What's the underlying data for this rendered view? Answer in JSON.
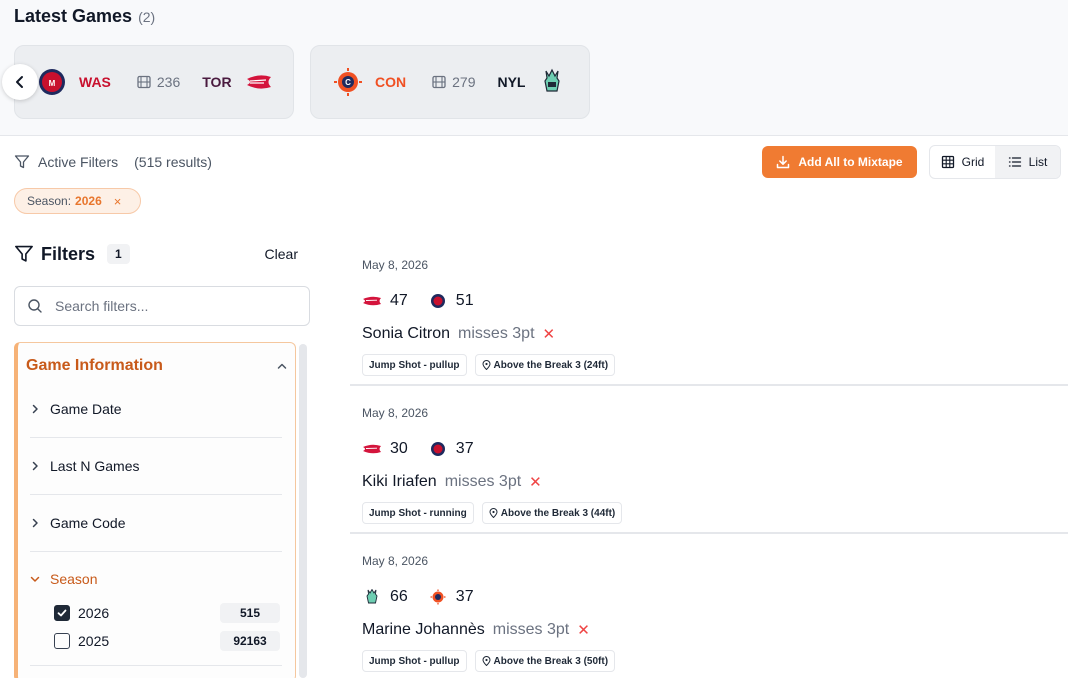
{
  "latest_games": {
    "title": "Latest Games",
    "count": "(2)",
    "games": [
      {
        "home": "WAS",
        "clips": "236",
        "away": "TOR",
        "home_color": "#c8102e",
        "away_color": "#4a1a3f"
      },
      {
        "home": "CON",
        "clips": "279",
        "away": "NYL",
        "home_color": "#f05023",
        "away_color": "#111827"
      }
    ]
  },
  "active_filters": {
    "label": "Active Filters",
    "results": "(515 results)",
    "chip_key": "Season:",
    "chip_value": "2026",
    "chip_remove": "×"
  },
  "toolbar": {
    "add_all": "Add All to Mixtape",
    "grid": "Grid",
    "list": "List",
    "accent": "#f07b32"
  },
  "filters": {
    "title": "Filters",
    "count": "1",
    "clear": "Clear",
    "search_placeholder": "Search filters...",
    "section_title": "Game Information",
    "items": [
      "Game Date",
      "Last N Games",
      "Game Code",
      "Season"
    ],
    "season_options": [
      {
        "label": "2026",
        "count": "515",
        "checked": true
      },
      {
        "label": "2025",
        "count": "92163",
        "checked": false
      }
    ]
  },
  "plays": [
    {
      "date": "May 8, 2026",
      "team1_score": "47",
      "team2_score": "51",
      "player": "Sonia Citron",
      "action": "misses 3pt",
      "tag1": "Jump Shot - pullup",
      "tag2": "Above the Break 3 (24ft)"
    },
    {
      "date": "May 8, 2026",
      "team1_score": "30",
      "team2_score": "37",
      "player": "Kiki Iriafen",
      "action": "misses 3pt",
      "tag1": "Jump Shot - running",
      "tag2": "Above the Break 3 (44ft)"
    },
    {
      "date": "May 8, 2026",
      "team1_score": "66",
      "team2_score": "37",
      "player": "Marine Johannès",
      "action": "misses 3pt",
      "tag1": "Jump Shot - pullup",
      "tag2": "Above the Break 3 (50ft)"
    }
  ]
}
